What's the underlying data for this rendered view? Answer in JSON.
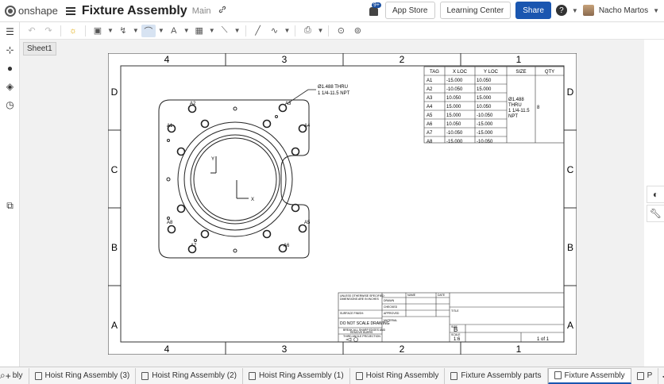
{
  "header": {
    "logo_text": "onshape",
    "title": "Fixture Assembly",
    "workspace": "Main",
    "notification_count": "9+",
    "app_store": "App Store",
    "learning_center": "Learning Center",
    "share": "Share",
    "help": "?",
    "user_name": "Nacho Martos"
  },
  "sheet": {
    "tab": "Sheet1"
  },
  "drawing": {
    "col_labels": [
      "4",
      "3",
      "2",
      "1"
    ],
    "row_labels": [
      "D",
      "C",
      "B",
      "A"
    ],
    "callout_line1": "Ø1.488 THRU",
    "callout_line2": "1 1/4-11.5 NPT",
    "hole_labels": [
      "A1",
      "A2",
      "A3",
      "A4",
      "A5",
      "A6",
      "A7",
      "A8"
    ],
    "axis_y": "Y",
    "axis_x": "X",
    "table_headers": [
      "TAG",
      "X LOC",
      "Y LOC",
      "SIZE",
      "QTY"
    ],
    "table_rows": [
      [
        "A1",
        "-15.000",
        "10.050"
      ],
      [
        "A2",
        "-10.050",
        "15.000"
      ],
      [
        "A3",
        "10.050",
        "15.000"
      ],
      [
        "A4",
        "15.000",
        "10.050"
      ],
      [
        "A5",
        "15.000",
        "-10.050"
      ],
      [
        "A6",
        "10.050",
        "-15.000"
      ],
      [
        "A7",
        "-10.050",
        "-15.000"
      ],
      [
        "A8",
        "-15.000",
        "-10.050"
      ]
    ],
    "size_line1": "Ø1.488",
    "size_line2": "THRU",
    "size_line3": "1 1/4-11.5",
    "size_line4": "NPT",
    "qty": "8",
    "tb_unless": "UNLESS OTHERWISE SPECIFIED:",
    "tb_dims": "DIMENSIONS ARE IN INCHES",
    "tb_surface": "SURFACE FINISH:",
    "tb_dnsd": "DO NOT SCALE DRAWING",
    "tb_break": "BREAK ALL SHARP EDGES AND",
    "tb_burrs": "REMOVE BURRS",
    "tb_projection": "THIRD ANGLE PROJECTION",
    "tb_name": "NAME",
    "tb_date": "DATE",
    "tb_drawn": "DRAWN",
    "tb_checked": "CHECKED",
    "tb_approved": "APPROVED",
    "tb_material": "MATERIAL",
    "tb_title": "TITLE",
    "tb_size_label": "SIZE",
    "tb_size": "B",
    "tb_scale_label": "SCALE",
    "tb_scale": "1:6",
    "tb_sheet": "1 of 1"
  },
  "bottom_tabs": [
    {
      "label": "bly",
      "active": false
    },
    {
      "label": "Hoist Ring Assembly (3)",
      "active": false
    },
    {
      "label": "Hoist Ring Assembly (2)",
      "active": false
    },
    {
      "label": "Hoist Ring Assembly (1)",
      "active": false
    },
    {
      "label": "Hoist Ring Assembly",
      "active": false
    },
    {
      "label": "Fixture Assembly parts",
      "active": false
    },
    {
      "label": "Fixture Assembly",
      "active": true
    },
    {
      "label": "P",
      "active": false
    }
  ],
  "colors": {
    "accent": "#1a56b0",
    "canvas": "#f1f1f1",
    "active_tool": "#d7e3f2"
  }
}
